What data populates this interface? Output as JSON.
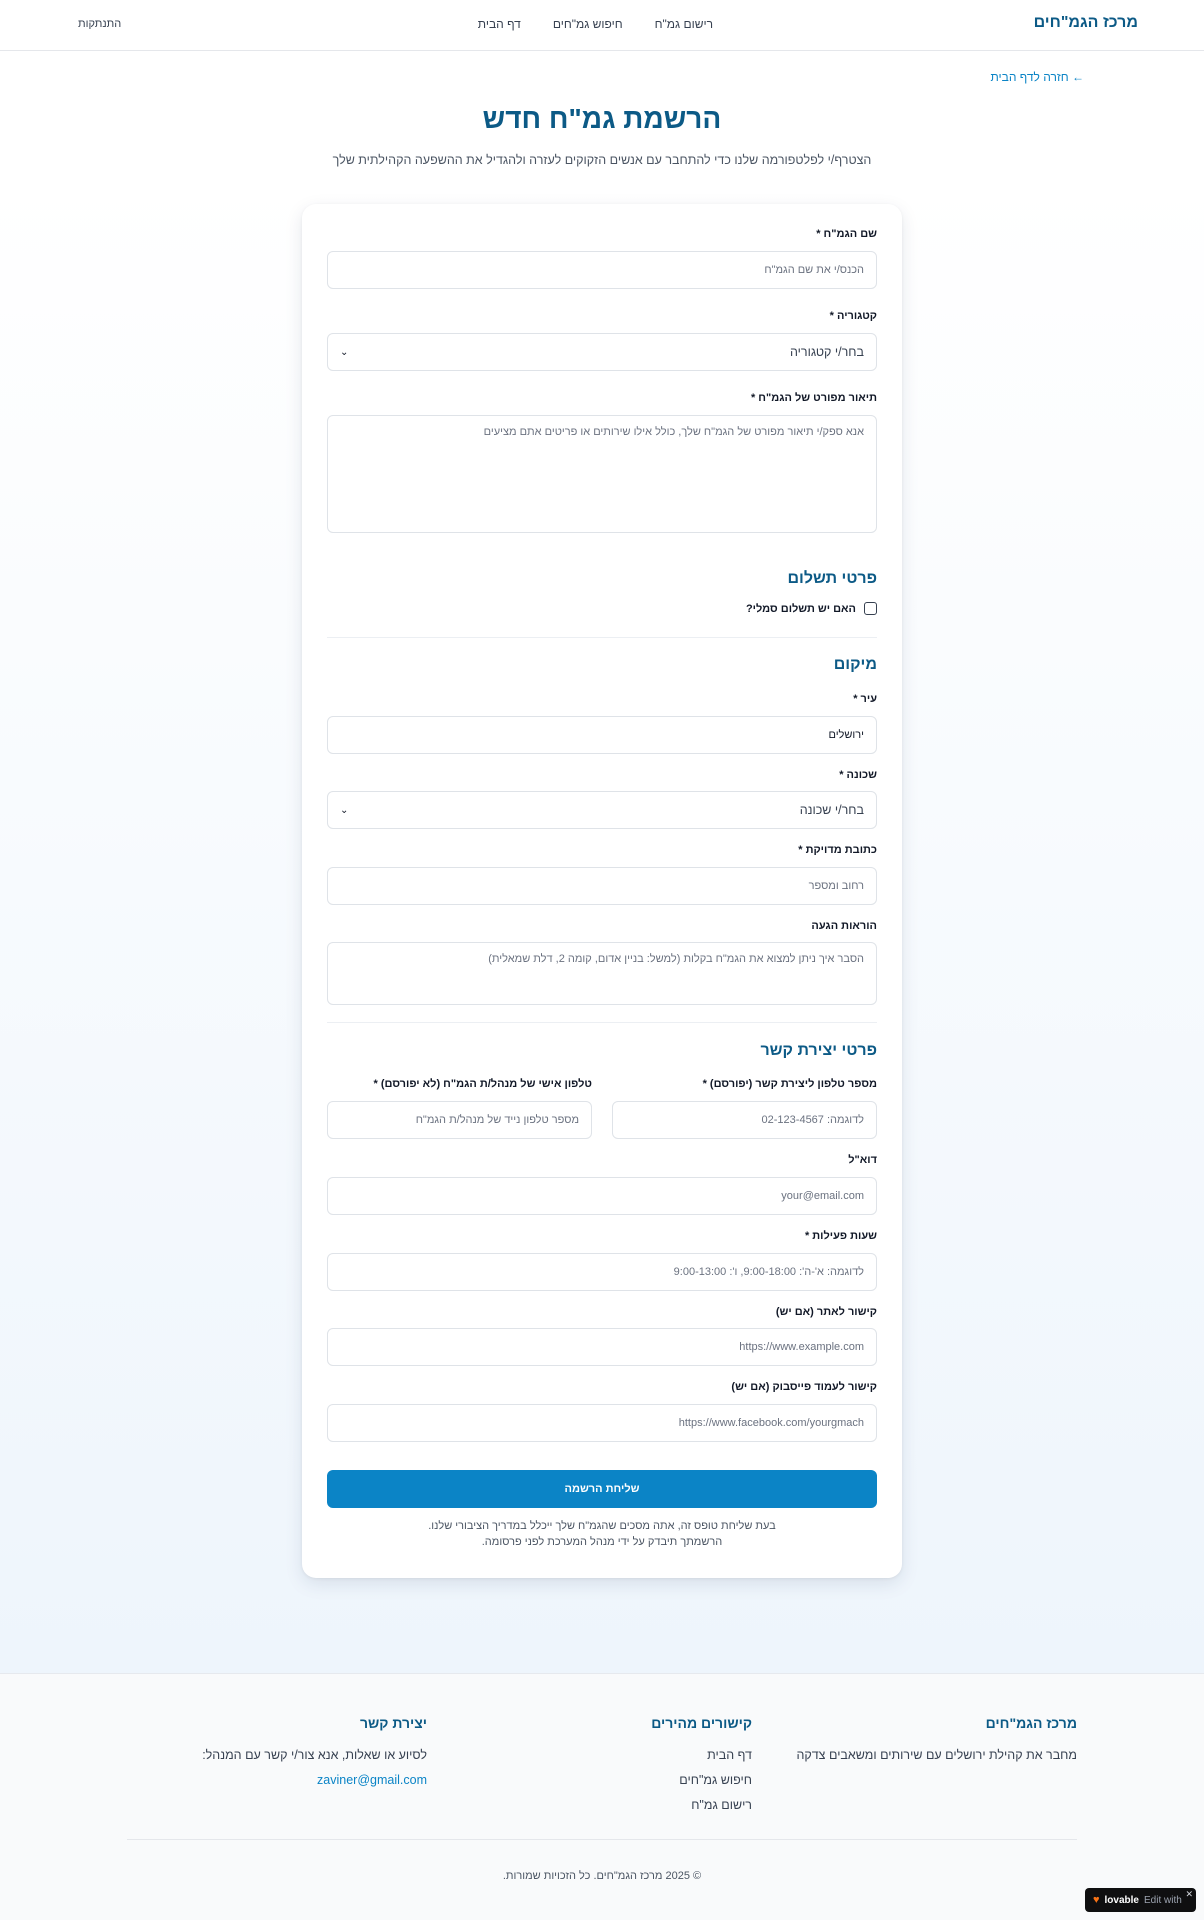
{
  "header": {
    "brand": "מרכז הגמ\"חים",
    "nav": [
      "רישום גמ\"ח",
      "חיפוש גמ\"חים",
      "דף הבית"
    ],
    "logout": "התנתקות"
  },
  "back_link": "← חזרה לדף הבית",
  "page": {
    "title": "הרשמת גמ\"ח חדש",
    "subtitle": "הצטרף/י לפלטפורמה שלנו כדי להתחבר עם אנשים הזקוקים לעזרה ולהגדיל את ההשפעה הקהילתית שלך"
  },
  "form": {
    "name_label": "שם הגמ\"ח *",
    "name_placeholder": "הכנס/י את שם הגמ\"ח",
    "category_label": "קטגוריה *",
    "category_value": "בחר/י קטגוריה",
    "description_label": "תיאור מפורט של הגמ\"ח *",
    "description_placeholder": "אנא ספק/י תיאור מפורט של הגמ\"ח שלך, כולל אילו שירותים או פריטים אתם מציעים",
    "payment_section": "פרטי תשלום",
    "payment_checkbox": "האם יש תשלום סמלי?",
    "location_section": "מיקום",
    "city_label": "עיר *",
    "city_value": "ירושלים",
    "neighborhood_label": "שכונה *",
    "neighborhood_value": "בחר/י שכונה",
    "address_label": "כתובת מדויקת *",
    "address_placeholder": "רחוב ומספר",
    "directions_label": "הוראות הגעה",
    "directions_placeholder": "הסבר איך ניתן למצוא את הגמ\"ח בקלות (למשל: בניין אדום, קומה 2, דלת שמאלית)",
    "contact_section": "פרטי יצירת קשר",
    "public_phone_label": "מספר טלפון ליצירת קשר (יפורסם) *",
    "public_phone_placeholder": "לדוגמה: 02-123-4567",
    "private_phone_label": "טלפון אישי של מנהל/ת הגמ\"ח (לא יפורסם) *",
    "private_phone_placeholder": "מספר טלפון נייד של מנהל/ת הגמ\"ח",
    "email_label": "דוא\"ל",
    "email_placeholder": "your@email.com",
    "hours_label": "שעות פעילות *",
    "hours_placeholder": "לדוגמה: א'-ה': 9:00-18:00, ו': 9:00-13:00",
    "website_label": "קישור לאתר (אם יש)",
    "website_placeholder": "https://www.example.com",
    "facebook_label": "קישור לעמוד פייסבוק (אם יש)",
    "facebook_placeholder": "https://www.facebook.com/yourgmach",
    "submit_label": "שליחת הרשמה",
    "note_line1": "בעת שליחת טופס זה, אתה מסכים שהגמ\"ח שלך ייכלל במדריך הציבורי שלנו.",
    "note_line2": "הרשמתך תיבדק על ידי מנהל המערכת לפני פרסומה."
  },
  "footer": {
    "about_title": "מרכז הגמ\"חים",
    "about_text": "מחבר את קהילת ירושלים עם שירותים ומשאבים צדקה",
    "links_title": "קישורים מהירים",
    "links": [
      "דף הבית",
      "חיפוש גמ\"חים",
      "רישום גמ\"ח"
    ],
    "contact_title": "יצירת קשר",
    "contact_text": "לסיוע או שאלות, אנא צור/י קשר עם המנהל:",
    "contact_email": "zaviner@gmail.com",
    "copyright": "© 2025 מרכז הגמ\"חים. כל הזכויות שמורות."
  },
  "badge": {
    "name": "lovable",
    "edit": "Edit with",
    "heart_icon": "heart-icon",
    "close_icon": "close-icon"
  }
}
